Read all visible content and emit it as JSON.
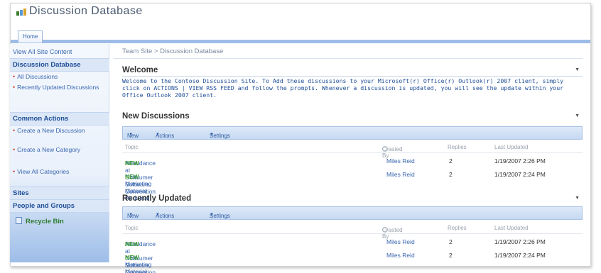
{
  "site": {
    "title": "Discussion Database"
  },
  "topnav": {
    "home_tab": "Home"
  },
  "leftnav": {
    "view_all": "View All Site Content",
    "discussion_header": "Discussion Database",
    "discussion_items": [
      "All Discussions",
      "Recently Updated Discussions"
    ],
    "common_header": "Common Actions",
    "common_items": [
      "Create a New Discussion",
      "Create a New Category",
      "View All Categories"
    ],
    "sites": "Sites",
    "people": "People and Groups",
    "recycle": "Recycle Bin"
  },
  "breadcrumb": {
    "root": "Team Site",
    "sep": ">",
    "current": "Discussion Database"
  },
  "welcome": {
    "title": "Welcome",
    "text": "Welcome to the Contoso Discussion Site.  To Add these discussions to your Microsoft(r) Office(r) Outlook(r) 2007 client, simply click on ACTIONS | VIEW RSS FEED and follow the prompts.  Whenever a discussion is updated, you will see the update within your Office Outlook 2007 client."
  },
  "toolbar": {
    "new": "New",
    "actions": "Actions",
    "settings": "Settings"
  },
  "columns": {
    "topic": "Topic",
    "created_by": "Created By",
    "replies": "Replies",
    "last_updated": "Last Updated"
  },
  "new_discussions": {
    "title": "New Discussions",
    "rows": [
      {
        "topic": "Attendance at Consumer Software Convention",
        "badge": "NEW",
        "created_by": "Miles Reid",
        "replies": "2",
        "last_updated": "1/19/2007 2:26 PM"
      },
      {
        "topic": "New Marketing Material Required",
        "badge": "NEW",
        "created_by": "Miles Reid",
        "replies": "2",
        "last_updated": "1/19/2007 2:24 PM"
      }
    ]
  },
  "recently_updated": {
    "title": "Recently Updated",
    "rows": [
      {
        "topic": "Attendance at Consumer Software Convention",
        "badge": "NEW",
        "created_by": "Miles Reid",
        "replies": "2",
        "last_updated": "1/19/2007 2:26 PM"
      },
      {
        "topic": "New Marketing Material Required",
        "badge": "NEW",
        "created_by": "Miles Reid",
        "replies": "2",
        "last_updated": "1/19/2007 2:24 PM"
      }
    ]
  },
  "colors": {
    "accent": "#3a67b0",
    "nav_band": "#9dbde8",
    "new_badge": "#3b9b2f"
  }
}
